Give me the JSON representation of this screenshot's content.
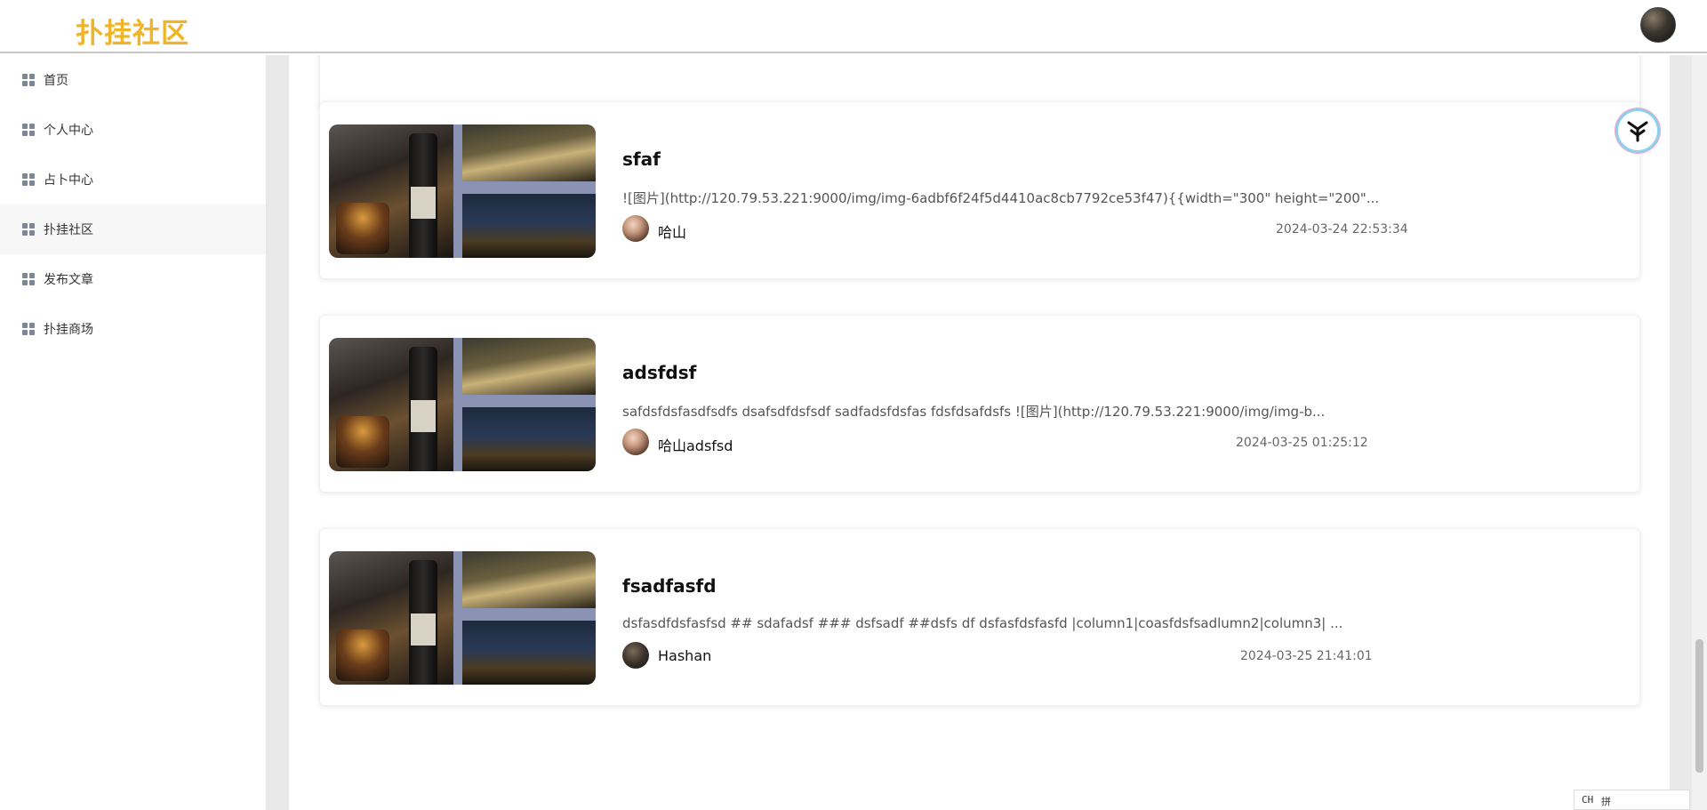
{
  "header": {
    "logo": "扑挂社区"
  },
  "sidebar": {
    "items": [
      {
        "label": "首页"
      },
      {
        "label": "个人中心"
      },
      {
        "label": "占卜中心"
      },
      {
        "label": "扑挂社区"
      },
      {
        "label": "发布文章"
      },
      {
        "label": "扑挂商场"
      }
    ]
  },
  "posts": [
    {
      "title": "sfaf",
      "excerpt": "![图片](http://120.79.53.221:9000/img/img-6adbf6f24f5d4410ac8cb7792ce53f47){{width=\"300\" height=\"200\"...",
      "author": "哈山",
      "date": "2024-03-24 22:53:34"
    },
    {
      "title": "adsfdsf",
      "excerpt": "safdsfdsfasdfsdfs dsafsdfdsfsdf sadfadsfdsfas fdsfdsafdsfs ![图片](http://120.79.53.221:9000/img/img-b...",
      "author": "哈山adsfsd",
      "date": "2024-03-25 01:25:12"
    },
    {
      "title": "fsadfasfd",
      "excerpt": "dsfasdfdsfasfsd ## sdafadsf ### dsfsadf ##dsfs df dsfasfdsfasfd |column1|coasfdsfsadlumn2|column3| ...",
      "author": "Hashan",
      "date": "2024-03-25 21:41:01"
    }
  ],
  "ime": {
    "lang": "CH",
    "mode": "拼"
  },
  "colors": {
    "logo": "#f0b429",
    "sidebar_icon": "#7d8896",
    "main_bg": "#e9e9e9"
  }
}
